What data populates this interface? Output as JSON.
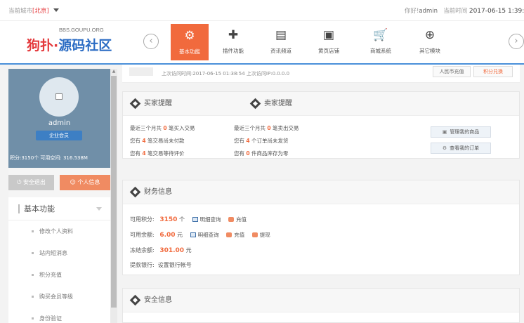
{
  "topbar": {
    "city_label": "当前城市",
    "city_value": "[北京]",
    "greeting": "你好!",
    "username": "admin",
    "time_label": "当前时间",
    "time_value": "2017-06-15 1:39:4"
  },
  "logo": {
    "url": "BBS.GOUPU.ORG",
    "name_red": "狗扑·",
    "name_blue": "源码社区"
  },
  "nav": {
    "items": [
      {
        "label": "基本功能",
        "icon": "gear-icon"
      },
      {
        "label": "插件功能",
        "icon": "puzzle-icon"
      },
      {
        "label": "资讯频道",
        "icon": "document-icon"
      },
      {
        "label": "黄页店铺",
        "icon": "store-icon"
      },
      {
        "label": "商城系统",
        "icon": "cart-icon"
      },
      {
        "label": "其它模块",
        "icon": "plus-circle-icon"
      }
    ],
    "prev_icon": "chevron-left-icon",
    "next_icon": "chevron-right-icon",
    "prev_glyph": "‹",
    "next_glyph": "›"
  },
  "profile": {
    "username": "admin",
    "badge": "企业会员",
    "stats": "积分:3150个  可用空间: 316.538M"
  },
  "sidebar": {
    "logout_label": "安全退出",
    "info_label": "个人信息",
    "menu_title": "基本功能",
    "items": [
      {
        "label": "修改个人资料"
      },
      {
        "label": "站内短消息"
      },
      {
        "label": "积分充值"
      },
      {
        "label": "购买会员等级"
      },
      {
        "label": "身份验证"
      }
    ]
  },
  "strip": {
    "last_visit": "上次访问时间:2017-06-15    01:38:54    上次访问IP:0.0.0.0",
    "btn_rmb": "人民币充值",
    "btn_points": "积分兑换"
  },
  "remind": {
    "buyer_title": "买家提醒",
    "seller_title": "卖家提醒",
    "buyer_rows": [
      {
        "pre": "最近三个月共",
        "num": "0",
        "post": "笔买入交易"
      },
      {
        "pre": "您有",
        "num": "4",
        "post": "笔交易尚未付款"
      },
      {
        "pre": "您有",
        "num": "4",
        "post": "笔交易等待评价"
      }
    ],
    "seller_rows": [
      {
        "pre": "最近三个月共",
        "num": "0",
        "post": "笔卖出交易"
      },
      {
        "pre": "您有",
        "num": "4",
        "post": "个订单尚未发货"
      },
      {
        "pre": "您有",
        "num": "0",
        "post": "件商品库存为零"
      }
    ],
    "btn_manage": "管理我的商品",
    "btn_orders": "查看我的订单"
  },
  "finance": {
    "title": "财务信息",
    "points_label": "可用积分:",
    "points_value": "3150",
    "points_unit": "个",
    "balance_label": "可用余额:",
    "balance_value": "6.00",
    "balance_unit": "元",
    "frozen_label": "冻结余额:",
    "frozen_value": "301.00",
    "frozen_unit": "元",
    "bank_label": "提款银行:",
    "bank_value": "设置银行帐号",
    "detail_label": "明细查询",
    "recharge_label": "充值",
    "withdraw_label": "提现"
  },
  "safe": {
    "title": "安全信息"
  }
}
